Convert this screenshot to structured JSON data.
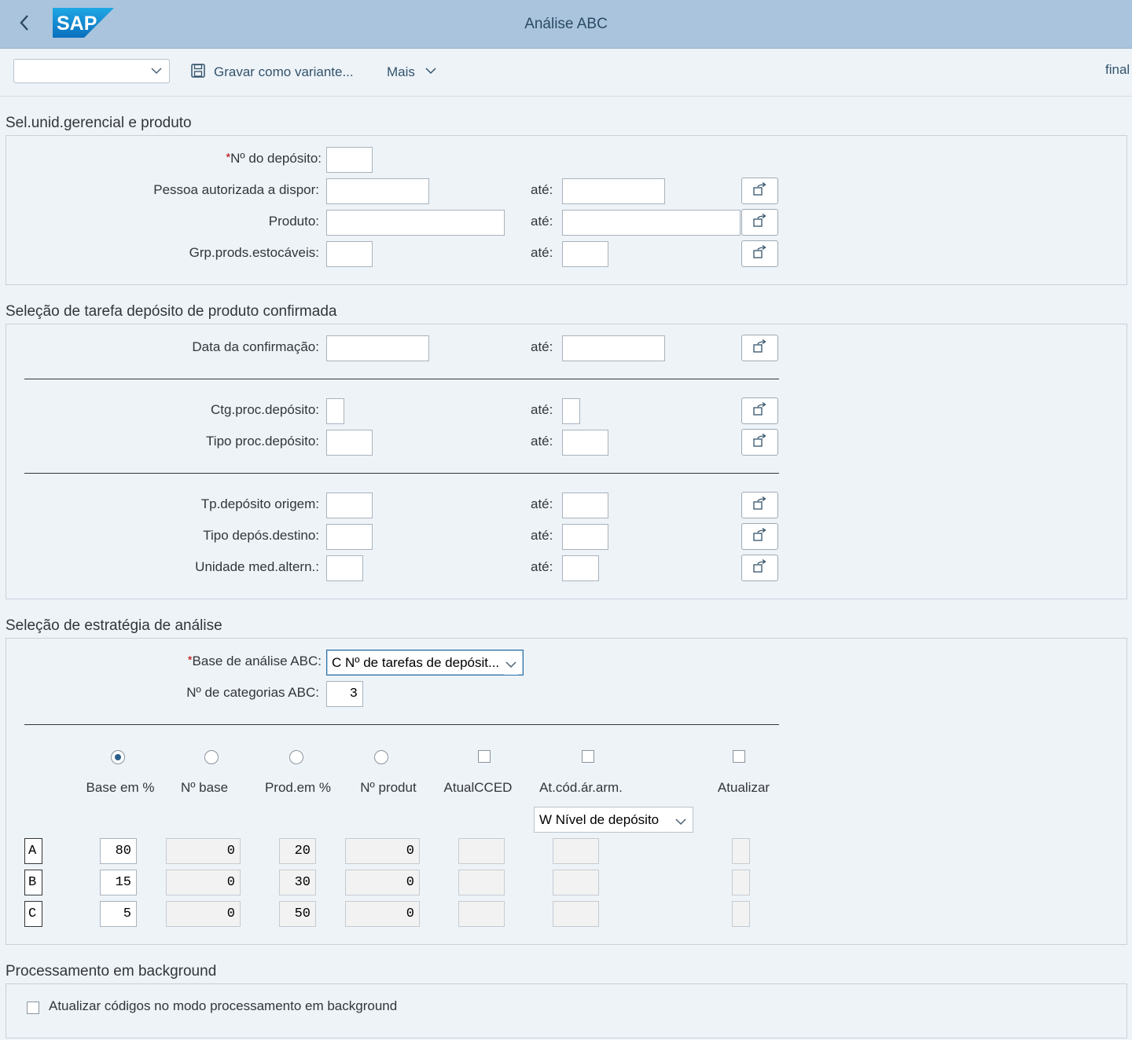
{
  "header": {
    "title": "Análise ABC",
    "logo_text": "SAP"
  },
  "toolbar": {
    "variant_value": "",
    "save_variant_label": "Gravar como variante...",
    "more_label": "Mais",
    "final_label": "final"
  },
  "section1": {
    "title": "Sel.unid.gerencial e produto",
    "warehouse_label": "Nº do depósito:",
    "warehouse_value": "",
    "rows": [
      {
        "label": "Pessoa autorizada a dispor:",
        "to": "até:",
        "from_value": "",
        "to_value": ""
      },
      {
        "label": "Produto:",
        "to": "até:",
        "from_value": "",
        "to_value": ""
      },
      {
        "label": "Grp.prods.estocáveis:",
        "to": "até:",
        "from_value": "",
        "to_value": ""
      }
    ]
  },
  "section2": {
    "title": "Seleção de tarefa depósito de produto confirmada",
    "rows": [
      {
        "label": "Data da confirmação:",
        "to": "até:",
        "from_value": "",
        "to_value": ""
      },
      {
        "label": "Ctg.proc.depósito:",
        "to": "até:",
        "from_value": "",
        "to_value": ""
      },
      {
        "label": "Tipo proc.depósito:",
        "to": "até:",
        "from_value": "",
        "to_value": ""
      },
      {
        "label": "Tp.depósito origem:",
        "to": "até:",
        "from_value": "",
        "to_value": ""
      },
      {
        "label": "Tipo depós.destino:",
        "to": "até:",
        "from_value": "",
        "to_value": ""
      },
      {
        "label": "Unidade med.altern.:",
        "to": "até:",
        "from_value": "",
        "to_value": ""
      }
    ]
  },
  "section3": {
    "title": "Seleção de estratégia de análise",
    "basis_label": "Base de análise ABC:",
    "basis_value": "C Nº de tarefas de depósit...",
    "categories_label": "Nº de categorias ABC:",
    "categories_value": "3",
    "columns": [
      "Base em %",
      "Nº base",
      "Prod.em %",
      "Nº produt",
      "AtualCCED",
      "At.cód.ár.arm.",
      "Atualizar"
    ],
    "level_select_value": "W Nível de depósito",
    "rows": [
      {
        "cat": "A",
        "base_pct": "80",
        "base_no": "0",
        "prod_pct": "20",
        "prod_no": "0"
      },
      {
        "cat": "B",
        "base_pct": "15",
        "base_no": "0",
        "prod_pct": "30",
        "prod_no": "0"
      },
      {
        "cat": "C",
        "base_pct": "5",
        "base_no": "0",
        "prod_pct": "50",
        "prod_no": "0"
      }
    ]
  },
  "section4": {
    "title": "Processamento em background",
    "checkbox_label": "Atualizar códigos no modo processamento em background"
  },
  "icons": {
    "back": "chevron-left-icon",
    "save": "floppy-disk-icon",
    "more": "chevron-down-icon",
    "multiple_selection": "multiple-selection-arrow-icon"
  },
  "colors": {
    "shell_bg": "#a9c4dc",
    "page_bg": "#eef3f8",
    "required": "#bb0000",
    "link_text": "#32536b"
  }
}
